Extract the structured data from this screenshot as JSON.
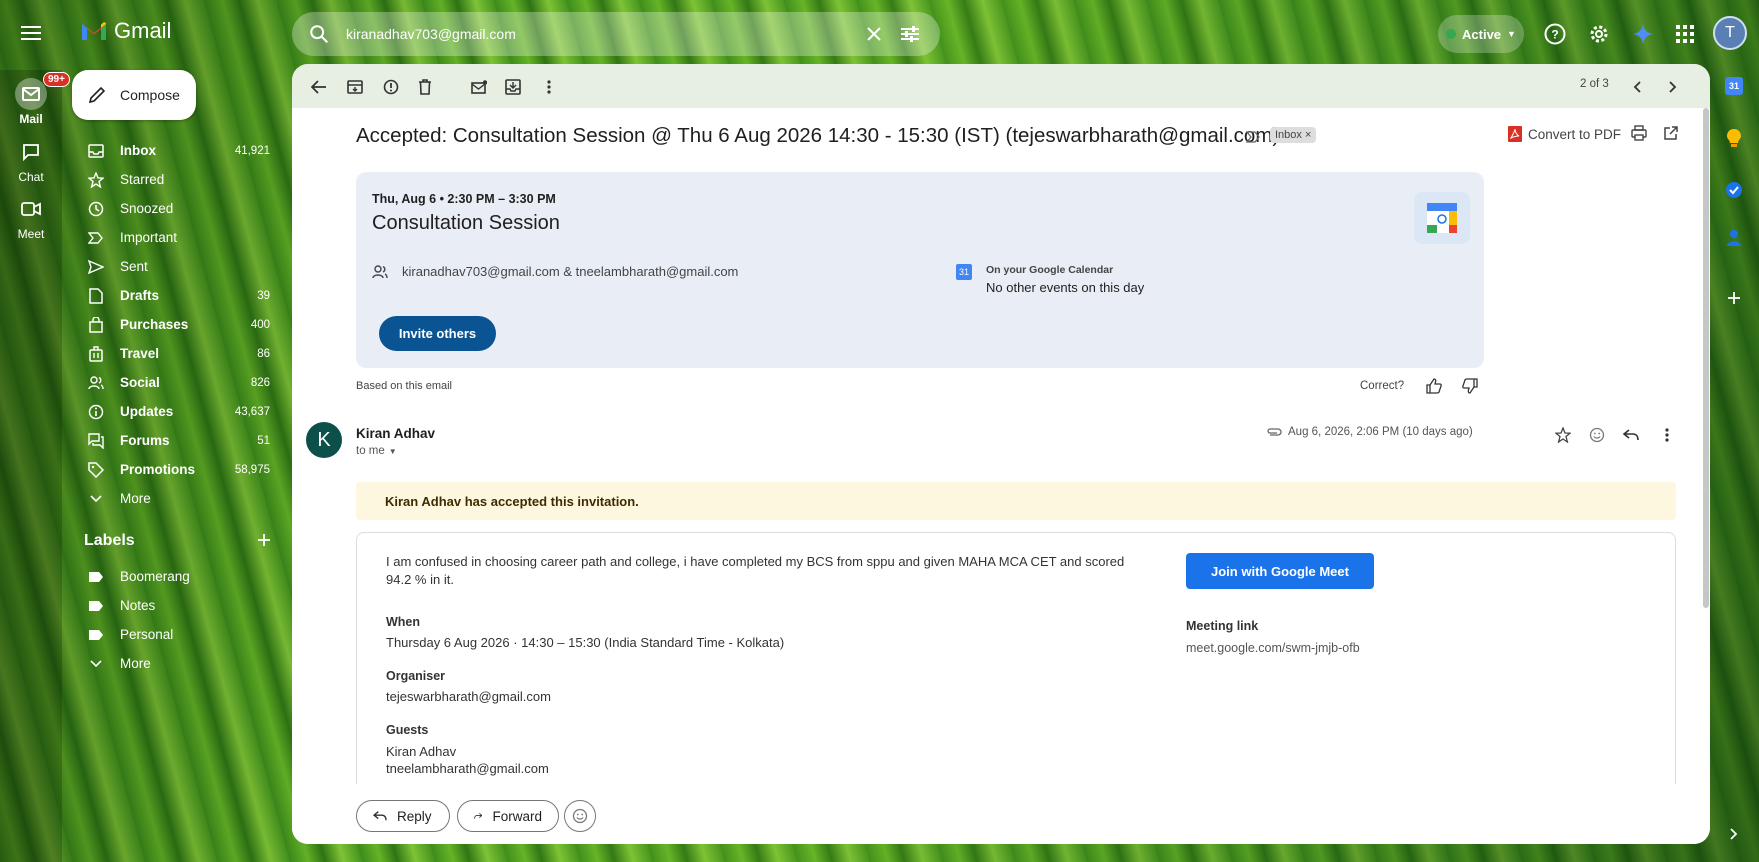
{
  "app": {
    "name": "Gmail"
  },
  "search": {
    "value": "kiranadhav703@gmail.com"
  },
  "status": {
    "label": "Active"
  },
  "account": {
    "initial": "T"
  },
  "rail": {
    "mail": {
      "label": "Mail",
      "badge": "99+"
    },
    "chat": {
      "label": "Chat"
    },
    "meet": {
      "label": "Meet"
    }
  },
  "compose": {
    "label": "Compose"
  },
  "nav": [
    {
      "label": "Inbox",
      "count": "41,921",
      "icon": "inbox-icon",
      "bold": true
    },
    {
      "label": "Starred",
      "count": "",
      "icon": "star-icon",
      "bold": false
    },
    {
      "label": "Snoozed",
      "count": "",
      "icon": "clock-icon",
      "bold": false
    },
    {
      "label": "Important",
      "count": "",
      "icon": "important-icon",
      "bold": false
    },
    {
      "label": "Sent",
      "count": "",
      "icon": "send-icon",
      "bold": false
    },
    {
      "label": "Drafts",
      "count": "39",
      "icon": "draft-icon",
      "bold": true
    },
    {
      "label": "Purchases",
      "count": "400",
      "icon": "shopping-icon",
      "bold": true
    },
    {
      "label": "Travel",
      "count": "86",
      "icon": "luggage-icon",
      "bold": true
    },
    {
      "label": "Social",
      "count": "826",
      "icon": "people-icon",
      "bold": true
    },
    {
      "label": "Updates",
      "count": "43,637",
      "icon": "info-icon",
      "bold": true
    },
    {
      "label": "Forums",
      "count": "51",
      "icon": "forum-icon",
      "bold": true
    },
    {
      "label": "Promotions",
      "count": "58,975",
      "icon": "tag-icon",
      "bold": true
    },
    {
      "label": "More",
      "count": "",
      "icon": "chevron-down-icon",
      "bold": false
    }
  ],
  "labels": {
    "heading": "Labels",
    "items": [
      {
        "label": "Boomerang"
      },
      {
        "label": "Notes"
      },
      {
        "label": "Personal"
      },
      {
        "label": "More"
      }
    ]
  },
  "toolbar": {
    "pager": "2 of 3"
  },
  "message": {
    "subject": "Accepted: Consultation Session @ Thu 6 Aug 2026 14:30 - 15:30 (IST) (tejeswarbharath@gmail.com)",
    "chip": "Inbox",
    "convert_pdf": "Convert to PDF",
    "event": {
      "date": "Thu, Aug 6 • 2:30 PM – 3:30 PM",
      "title": "Consultation Session",
      "people": "kiranadhav703@gmail.com & tneelambharath@gmail.com",
      "calendar_heading": "On your Google Calendar",
      "calendar_text": "No other events on this day",
      "calendar_day": "31",
      "invite_label": "Invite others"
    },
    "based_on": "Based on this email",
    "correct": "Correct?",
    "sender": {
      "name": "Kiran Adhav",
      "initial": "K",
      "to": "to me",
      "date": "Aug 6, 2026, 2:06 PM (10 days ago)"
    },
    "accepted_banner": "Kiran Adhav has accepted this invitation.",
    "body": {
      "description": "I am confused in choosing career path and college, i have completed my BCS from sppu and given MAHA MCA CET and scored 94.2 % in it.",
      "when_label": "When",
      "when_value": "Thursday 6 Aug 2026 · 14:30 – 15:30 (India Standard Time - Kolkata)",
      "organiser_label": "Organiser",
      "organiser_value": "tejeswarbharath@gmail.com",
      "guests_label": "Guests",
      "guest1": "Kiran Adhav",
      "guest2": "tneelambharath@gmail.com",
      "join_label": "Join with Google Meet",
      "meeting_link_label": "Meeting link",
      "meeting_link": "meet.google.com/swm-jmjb-ofb"
    },
    "reply_label": "Reply",
    "forward_label": "Forward"
  },
  "colors": {
    "accent": "#0b57d0",
    "join": "#1a73e8",
    "banner": "#fef7e0",
    "card": "#e9eef6"
  }
}
